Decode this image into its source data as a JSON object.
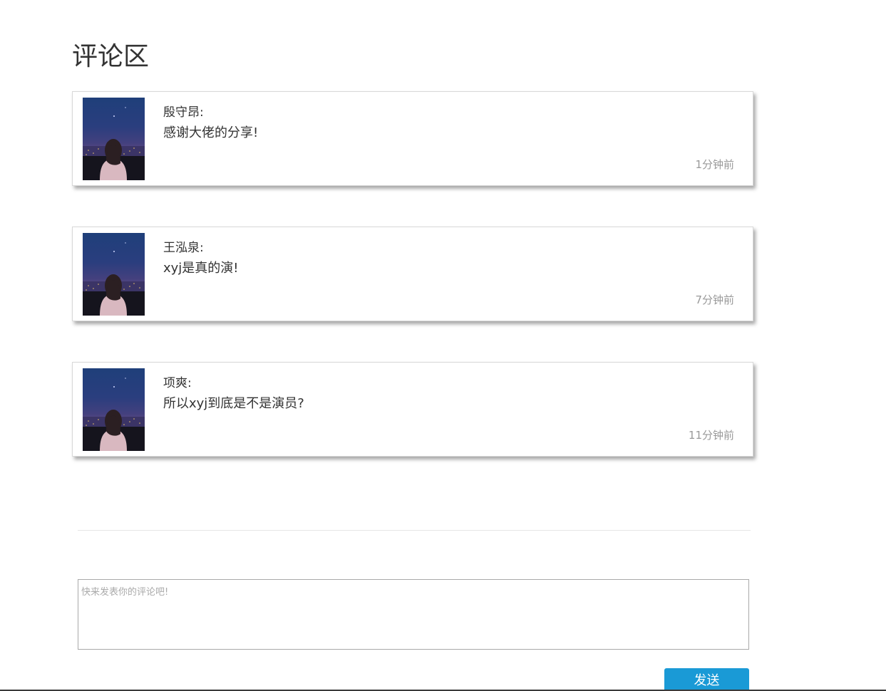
{
  "page": {
    "title": "评论区"
  },
  "comments": [
    {
      "author": "殷守昂:",
      "text": "感谢大佬的分享!",
      "time": "1分钟前",
      "avatar_icon": "avatar-night-city-girl"
    },
    {
      "author": "王泓泉:",
      "text": "xyj是真的演!",
      "time": "7分钟前",
      "avatar_icon": "avatar-night-city-girl"
    },
    {
      "author": "项爽:",
      "text": "所以xyj到底是不是演员?",
      "time": "11分钟前",
      "avatar_icon": "avatar-night-city-girl"
    }
  ],
  "composer": {
    "placeholder": "快来发表你的评论吧!",
    "value": "",
    "send_label": "发送"
  },
  "colors": {
    "accent": "#1a9ad6",
    "text": "#333333",
    "muted": "#999999",
    "border": "#d8d8d8"
  }
}
